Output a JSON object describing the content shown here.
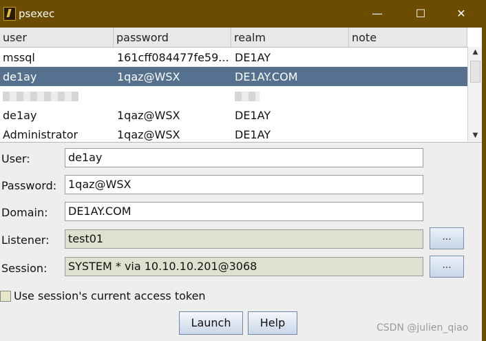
{
  "window": {
    "title": "psexec",
    "minimize": "—",
    "maximize": "☐",
    "close": "✕"
  },
  "table": {
    "columns": [
      "user",
      "password",
      "realm",
      "note"
    ],
    "rows": [
      {
        "user": "mssql",
        "password": "161cff084477fe59...",
        "realm": "DE1AY",
        "note": ""
      },
      {
        "user": "de1ay",
        "password": "1qaz@WSX",
        "realm": "DE1AY.COM",
        "note": ""
      },
      {
        "user": "",
        "password": "",
        "realm": "",
        "note": ""
      },
      {
        "user": "de1ay",
        "password": "1qaz@WSX",
        "realm": "DE1AY",
        "note": ""
      },
      {
        "user": "Administrator",
        "password": "1qaz@WSX",
        "realm": "DE1AY",
        "note": ""
      }
    ]
  },
  "form": {
    "user_label": "User:",
    "user_value": "de1ay",
    "password_label": "Password:",
    "password_value": "1qaz@WSX",
    "domain_label": "Domain:",
    "domain_value": "DE1AY.COM",
    "listener_label": "Listener:",
    "listener_value": "test01",
    "session_label": "Session:",
    "session_value": "SYSTEM * via  10.10.10.201@3068",
    "browse_label": "...",
    "token_label": "Use session's current access token",
    "launch_label": "Launch",
    "help_label": "Help"
  },
  "watermark": "CSDN @julien_qiao"
}
